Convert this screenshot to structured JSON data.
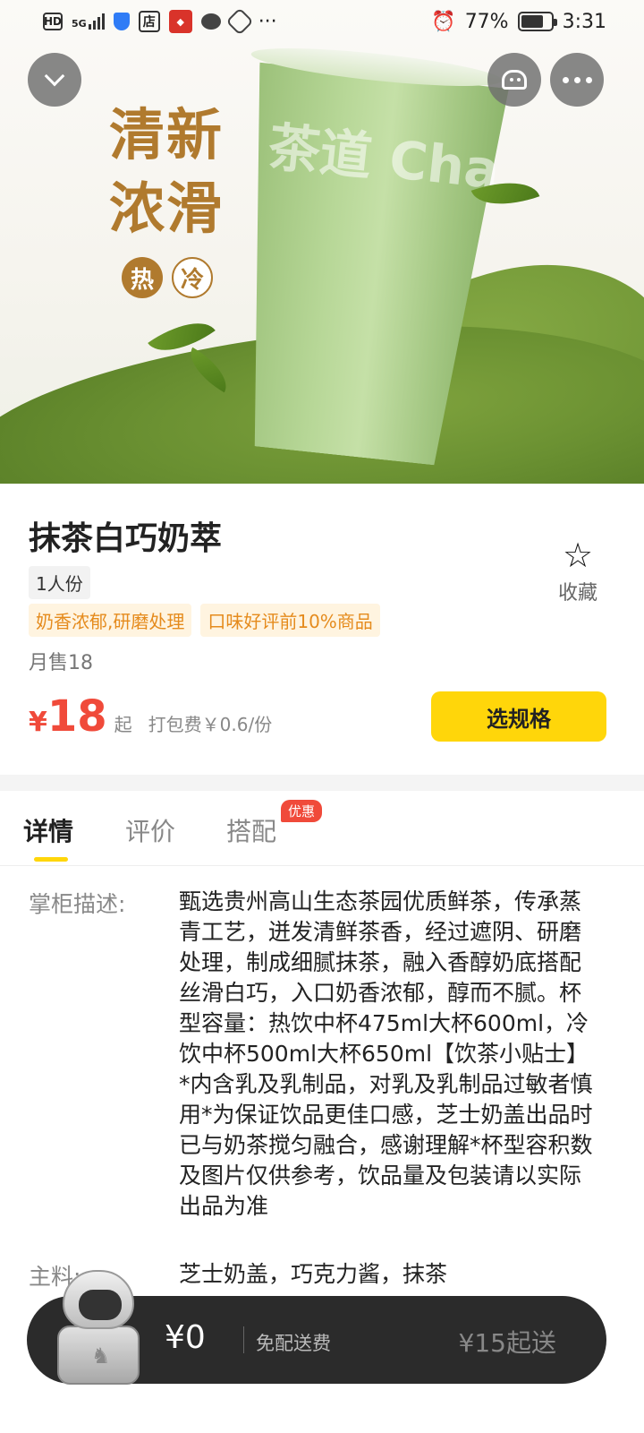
{
  "status_bar": {
    "hd": "HD",
    "network": "5G",
    "store_icon": "店",
    "more": "···",
    "battery_pct": "77%",
    "battery_level": 0.77,
    "time": "3:31"
  },
  "hero": {
    "slogan_line1": "清新",
    "slogan_line2": "浓滑",
    "hot": "热",
    "cold": "冷",
    "watermark": "茶道 Cha"
  },
  "product": {
    "name": "抹茶白巧奶萃",
    "portion": "1人份",
    "tags": [
      "奶香浓郁,研磨处理",
      "口味好评前10%商品"
    ],
    "favorite_label": "收藏",
    "monthly_sales": "月售18",
    "currency": "¥",
    "price": "18",
    "price_suffix": "起",
    "packaging_fee": "打包费￥0.6/份",
    "select_spec_label": "选规格"
  },
  "tabs": {
    "details": "详情",
    "reviews": "评价",
    "pairing": "搭配",
    "promo_badge": "优惠"
  },
  "details": {
    "desc_label": "掌柜描述:",
    "desc_text": "甄选贵州高山生态茶园优质鲜茶，传承蒸青工艺，迸发清鲜茶香，经过遮阴、研磨处理，制成细腻抹茶，融入香醇奶底搭配丝滑白巧，入口奶香浓郁，醇而不腻。杯型容量：热饮中杯475ml大杯600ml，冷饮中杯500ml大杯650ml【饮茶小贴士】*内含乳及乳制品，对乳及乳制品过敏者慎用*为保证饮品更佳口感，芝士奶盖出品时已与奶茶搅匀融合，感谢理解*杯型容积数及图片仅供参考，饮品量及包装请以实际出品为准",
    "ingredients_label": "主料:",
    "ingredients_text": "芝士奶盖，巧克力酱，抹茶"
  },
  "cart": {
    "amount": "¥0",
    "shipping": "免配送费",
    "min_order": "¥15起送"
  },
  "colors": {
    "accent_yellow": "#ffd60a",
    "price_red": "#f04a3a",
    "tag_orange": "#e58b1d",
    "cart_dark": "#2b2b2b"
  }
}
